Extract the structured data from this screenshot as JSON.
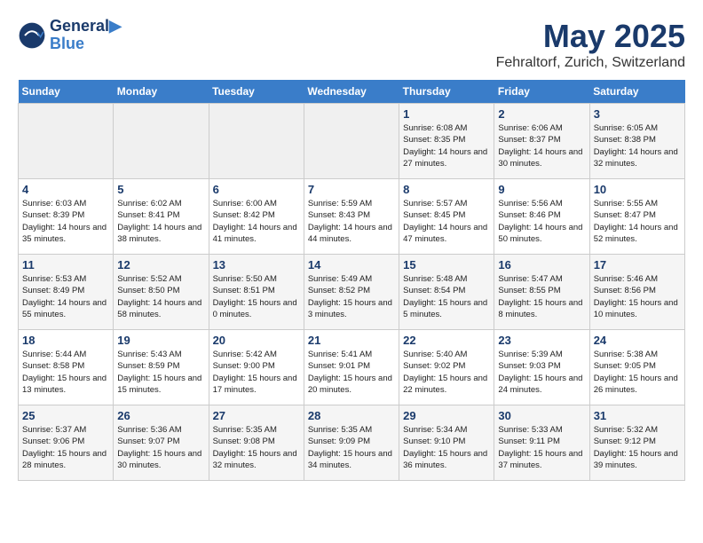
{
  "header": {
    "logo_line1": "General",
    "logo_line2": "Blue",
    "month": "May 2025",
    "location": "Fehraltorf, Zurich, Switzerland"
  },
  "days_of_week": [
    "Sunday",
    "Monday",
    "Tuesday",
    "Wednesday",
    "Thursday",
    "Friday",
    "Saturday"
  ],
  "weeks": [
    [
      {
        "day": "",
        "empty": true
      },
      {
        "day": "",
        "empty": true
      },
      {
        "day": "",
        "empty": true
      },
      {
        "day": "",
        "empty": true
      },
      {
        "day": "1",
        "sunrise": "6:08 AM",
        "sunset": "8:35 PM",
        "daylight": "14 hours and 27 minutes."
      },
      {
        "day": "2",
        "sunrise": "6:06 AM",
        "sunset": "8:37 PM",
        "daylight": "14 hours and 30 minutes."
      },
      {
        "day": "3",
        "sunrise": "6:05 AM",
        "sunset": "8:38 PM",
        "daylight": "14 hours and 32 minutes."
      }
    ],
    [
      {
        "day": "4",
        "sunrise": "6:03 AM",
        "sunset": "8:39 PM",
        "daylight": "14 hours and 35 minutes."
      },
      {
        "day": "5",
        "sunrise": "6:02 AM",
        "sunset": "8:41 PM",
        "daylight": "14 hours and 38 minutes."
      },
      {
        "day": "6",
        "sunrise": "6:00 AM",
        "sunset": "8:42 PM",
        "daylight": "14 hours and 41 minutes."
      },
      {
        "day": "7",
        "sunrise": "5:59 AM",
        "sunset": "8:43 PM",
        "daylight": "14 hours and 44 minutes."
      },
      {
        "day": "8",
        "sunrise": "5:57 AM",
        "sunset": "8:45 PM",
        "daylight": "14 hours and 47 minutes."
      },
      {
        "day": "9",
        "sunrise": "5:56 AM",
        "sunset": "8:46 PM",
        "daylight": "14 hours and 50 minutes."
      },
      {
        "day": "10",
        "sunrise": "5:55 AM",
        "sunset": "8:47 PM",
        "daylight": "14 hours and 52 minutes."
      }
    ],
    [
      {
        "day": "11",
        "sunrise": "5:53 AM",
        "sunset": "8:49 PM",
        "daylight": "14 hours and 55 minutes."
      },
      {
        "day": "12",
        "sunrise": "5:52 AM",
        "sunset": "8:50 PM",
        "daylight": "14 hours and 58 minutes."
      },
      {
        "day": "13",
        "sunrise": "5:50 AM",
        "sunset": "8:51 PM",
        "daylight": "15 hours and 0 minutes."
      },
      {
        "day": "14",
        "sunrise": "5:49 AM",
        "sunset": "8:52 PM",
        "daylight": "15 hours and 3 minutes."
      },
      {
        "day": "15",
        "sunrise": "5:48 AM",
        "sunset": "8:54 PM",
        "daylight": "15 hours and 5 minutes."
      },
      {
        "day": "16",
        "sunrise": "5:47 AM",
        "sunset": "8:55 PM",
        "daylight": "15 hours and 8 minutes."
      },
      {
        "day": "17",
        "sunrise": "5:46 AM",
        "sunset": "8:56 PM",
        "daylight": "15 hours and 10 minutes."
      }
    ],
    [
      {
        "day": "18",
        "sunrise": "5:44 AM",
        "sunset": "8:58 PM",
        "daylight": "15 hours and 13 minutes."
      },
      {
        "day": "19",
        "sunrise": "5:43 AM",
        "sunset": "8:59 PM",
        "daylight": "15 hours and 15 minutes."
      },
      {
        "day": "20",
        "sunrise": "5:42 AM",
        "sunset": "9:00 PM",
        "daylight": "15 hours and 17 minutes."
      },
      {
        "day": "21",
        "sunrise": "5:41 AM",
        "sunset": "9:01 PM",
        "daylight": "15 hours and 20 minutes."
      },
      {
        "day": "22",
        "sunrise": "5:40 AM",
        "sunset": "9:02 PM",
        "daylight": "15 hours and 22 minutes."
      },
      {
        "day": "23",
        "sunrise": "5:39 AM",
        "sunset": "9:03 PM",
        "daylight": "15 hours and 24 minutes."
      },
      {
        "day": "24",
        "sunrise": "5:38 AM",
        "sunset": "9:05 PM",
        "daylight": "15 hours and 26 minutes."
      }
    ],
    [
      {
        "day": "25",
        "sunrise": "5:37 AM",
        "sunset": "9:06 PM",
        "daylight": "15 hours and 28 minutes."
      },
      {
        "day": "26",
        "sunrise": "5:36 AM",
        "sunset": "9:07 PM",
        "daylight": "15 hours and 30 minutes."
      },
      {
        "day": "27",
        "sunrise": "5:35 AM",
        "sunset": "9:08 PM",
        "daylight": "15 hours and 32 minutes."
      },
      {
        "day": "28",
        "sunrise": "5:35 AM",
        "sunset": "9:09 PM",
        "daylight": "15 hours and 34 minutes."
      },
      {
        "day": "29",
        "sunrise": "5:34 AM",
        "sunset": "9:10 PM",
        "daylight": "15 hours and 36 minutes."
      },
      {
        "day": "30",
        "sunrise": "5:33 AM",
        "sunset": "9:11 PM",
        "daylight": "15 hours and 37 minutes."
      },
      {
        "day": "31",
        "sunrise": "5:32 AM",
        "sunset": "9:12 PM",
        "daylight": "15 hours and 39 minutes."
      }
    ]
  ]
}
